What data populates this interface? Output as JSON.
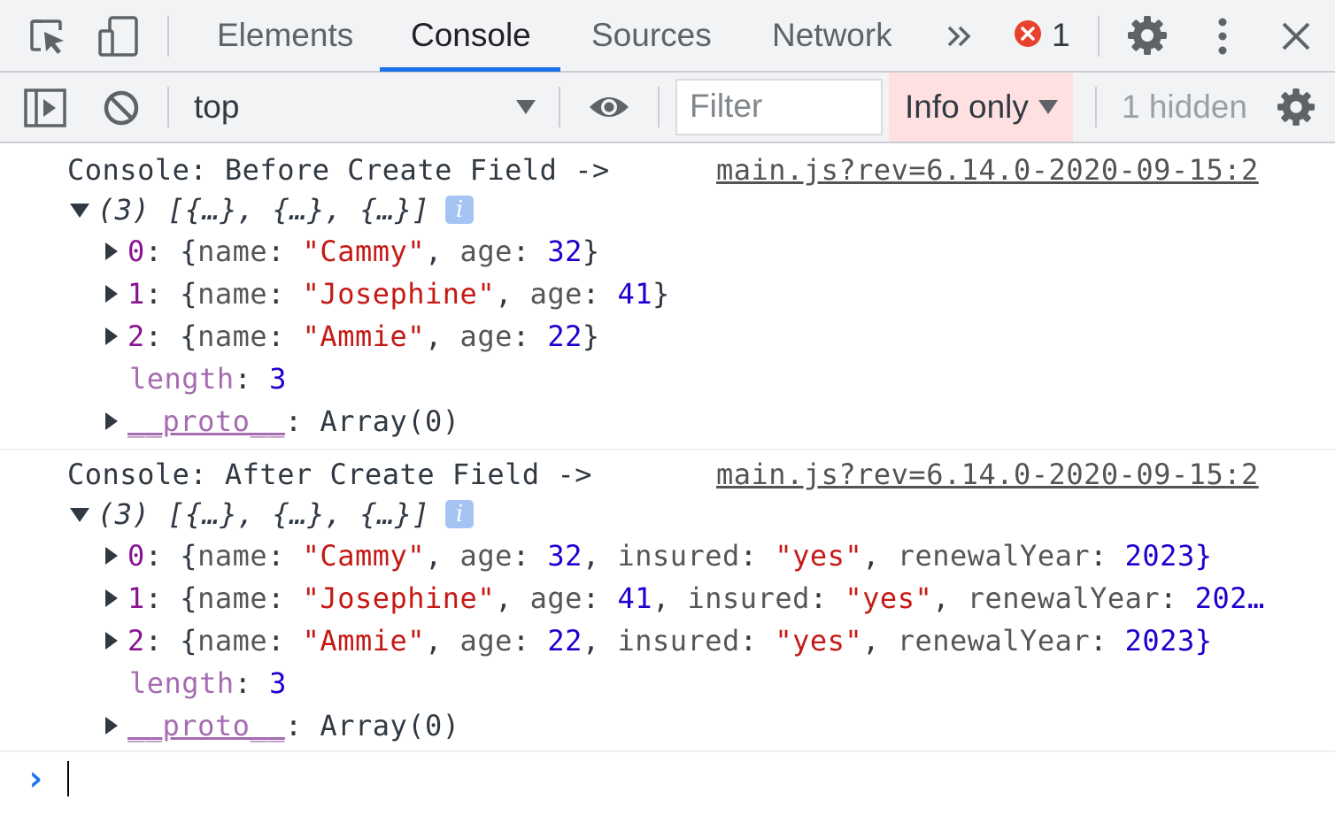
{
  "tabbar": {
    "tabs": [
      {
        "label": "Elements"
      },
      {
        "label": "Console"
      },
      {
        "label": "Sources"
      },
      {
        "label": "Network"
      }
    ],
    "more_icon": "double-chevron-right-icon",
    "error_count": "1",
    "active_tab": "Console",
    "accent_color": "#1a73e8",
    "error_color": "#e8412c"
  },
  "toolbar": {
    "context": "top",
    "filter_placeholder": "Filter",
    "levels_label": "Info only",
    "hidden_label": "1 hidden",
    "levels_bg": "#fde0df"
  },
  "console": {
    "messages": [
      {
        "label": "Console: Before Create Field ->",
        "source": "main.js?rev=6.14.0-2020-09-15:2",
        "summary": "(3) [{…}, {…}, {…}]",
        "items": [
          {
            "idx": "0",
            "name": "\"Cammy\"",
            "age": "32"
          },
          {
            "idx": "1",
            "name": "\"Josephine\"",
            "age": "41"
          },
          {
            "idx": "2",
            "name": "\"Ammie\"",
            "age": "22"
          }
        ],
        "length_key": "length",
        "length_value": "3",
        "proto_key": "__proto__",
        "proto_value": "Array(0)"
      },
      {
        "label": "Console: After Create Field ->",
        "source": "main.js?rev=6.14.0-2020-09-15:2",
        "summary": "(3) [{…}, {…}, {…}]",
        "items": [
          {
            "idx": "0",
            "name": "\"Cammy\"",
            "age": "32",
            "insured": "\"yes\"",
            "renewal": "2023}"
          },
          {
            "idx": "1",
            "name": "\"Josephine\"",
            "age": "41",
            "insured": "\"yes\"",
            "renewal": "202…"
          },
          {
            "idx": "2",
            "name": "\"Ammie\"",
            "age": "22",
            "insured": "\"yes\"",
            "renewal": "2023}"
          }
        ],
        "length_key": "length",
        "length_value": "3",
        "proto_key": "__proto__",
        "proto_value": "Array(0)"
      }
    ],
    "keys": {
      "name": "name",
      "age": "age",
      "insured": "insured",
      "renewal": "renewalYear"
    },
    "prompt_symbol": "›"
  }
}
